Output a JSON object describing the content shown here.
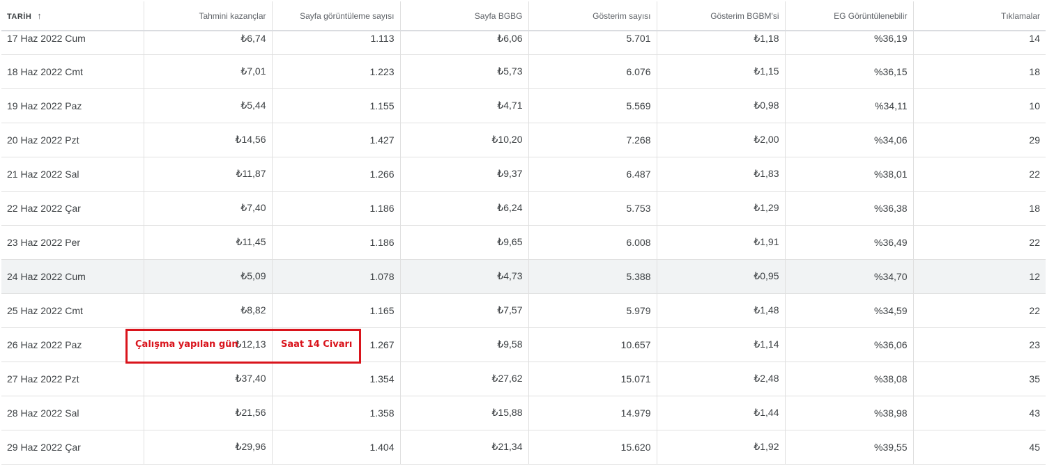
{
  "table": {
    "headers": {
      "date": "TARİH",
      "earnings": "Tahmini kazançlar",
      "pageviews": "Sayfa görüntüleme sayısı",
      "page_rpm": "Sayfa BGBG",
      "impressions": "Gösterim sayısı",
      "impression_rpm": "Gösterim BGBM'si",
      "viewable": "EG Görüntülenebilir",
      "clicks": "Tıklamalar"
    },
    "sort_icon": "arrow-up-icon",
    "rows": [
      {
        "date": "17 Haz 2022 Cum",
        "earnings": "₺6,74",
        "pageviews": "1.113",
        "page_rpm": "₺6,06",
        "impressions": "5.701",
        "impression_rpm": "₺1,18",
        "viewable": "%36,19",
        "clicks": "14"
      },
      {
        "date": "18 Haz 2022 Cmt",
        "earnings": "₺7,01",
        "pageviews": "1.223",
        "page_rpm": "₺5,73",
        "impressions": "6.076",
        "impression_rpm": "₺1,15",
        "viewable": "%36,15",
        "clicks": "18"
      },
      {
        "date": "19 Haz 2022 Paz",
        "earnings": "₺5,44",
        "pageviews": "1.155",
        "page_rpm": "₺4,71",
        "impressions": "5.569",
        "impression_rpm": "₺0,98",
        "viewable": "%34,11",
        "clicks": "10"
      },
      {
        "date": "20 Haz 2022 Pzt",
        "earnings": "₺14,56",
        "pageviews": "1.427",
        "page_rpm": "₺10,20",
        "impressions": "7.268",
        "impression_rpm": "₺2,00",
        "viewable": "%34,06",
        "clicks": "29"
      },
      {
        "date": "21 Haz 2022 Sal",
        "earnings": "₺11,87",
        "pageviews": "1.266",
        "page_rpm": "₺9,37",
        "impressions": "6.487",
        "impression_rpm": "₺1,83",
        "viewable": "%38,01",
        "clicks": "22"
      },
      {
        "date": "22 Haz 2022 Çar",
        "earnings": "₺7,40",
        "pageviews": "1.186",
        "page_rpm": "₺6,24",
        "impressions": "5.753",
        "impression_rpm": "₺1,29",
        "viewable": "%36,38",
        "clicks": "18"
      },
      {
        "date": "23 Haz 2022 Per",
        "earnings": "₺11,45",
        "pageviews": "1.186",
        "page_rpm": "₺9,65",
        "impressions": "6.008",
        "impression_rpm": "₺1,91",
        "viewable": "%36,49",
        "clicks": "22"
      },
      {
        "date": "24 Haz 2022 Cum",
        "earnings": "₺5,09",
        "pageviews": "1.078",
        "page_rpm": "₺4,73",
        "impressions": "5.388",
        "impression_rpm": "₺0,95",
        "viewable": "%34,70",
        "clicks": "12"
      },
      {
        "date": "25 Haz 2022 Cmt",
        "earnings": "₺8,82",
        "pageviews": "1.165",
        "page_rpm": "₺7,57",
        "impressions": "5.979",
        "impression_rpm": "₺1,48",
        "viewable": "%34,59",
        "clicks": "22"
      },
      {
        "date": "26 Haz 2022 Paz",
        "earnings": "₺12,13",
        "pageviews": "1.267",
        "page_rpm": "₺9,58",
        "impressions": "10.657",
        "impression_rpm": "₺1,14",
        "viewable": "%36,06",
        "clicks": "23"
      },
      {
        "date": "27 Haz 2022 Pzt",
        "earnings": "₺37,40",
        "pageviews": "1.354",
        "page_rpm": "₺27,62",
        "impressions": "15.071",
        "impression_rpm": "₺2,48",
        "viewable": "%38,08",
        "clicks": "35"
      },
      {
        "date": "28 Haz 2022 Sal",
        "earnings": "₺21,56",
        "pageviews": "1.358",
        "page_rpm": "₺15,88",
        "impressions": "14.979",
        "impression_rpm": "₺1,44",
        "viewable": "%38,98",
        "clicks": "43"
      },
      {
        "date": "29 Haz 2022 Çar",
        "earnings": "₺29,96",
        "pageviews": "1.404",
        "page_rpm": "₺21,34",
        "impressions": "15.620",
        "impression_rpm": "₺1,92",
        "viewable": "%39,55",
        "clicks": "45"
      }
    ]
  },
  "annotation": {
    "label_1": "Çalışma yapılan gün",
    "label_2": "Saat 14 Civarı",
    "color": "#d9141c"
  },
  "colors": {
    "header_text": "#5f6368",
    "cell_text": "#3c4043",
    "highlight_row": "#f1f3f4",
    "border": "#e0e0e0"
  }
}
